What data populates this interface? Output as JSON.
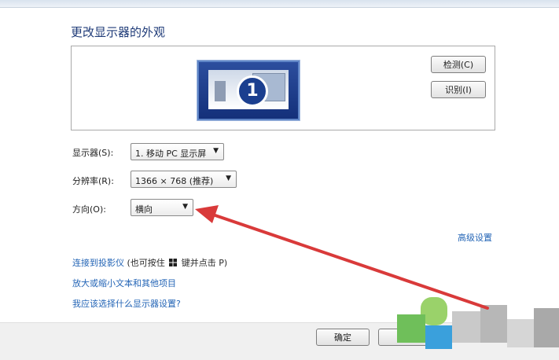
{
  "page": {
    "title": "更改显示器的外观"
  },
  "preview": {
    "monitor_number": "1",
    "detect_label": "检测(C)",
    "identify_label": "识别(I)"
  },
  "settings": {
    "display_label": "显示器(S):",
    "display_value": "1. 移动 PC 显示屏",
    "resolution_label": "分辨率(R):",
    "resolution_value": "1366 × 768 (推荐)",
    "orientation_label": "方向(O):",
    "orientation_value": "横向"
  },
  "links": {
    "advanced": "高级设置",
    "projector": "连接到投影仪",
    "projector_hint_pre": "(也可按住",
    "projector_hint_post": "键并点击 P)",
    "text_size": "放大或缩小文本和其他项目",
    "which_settings": "我应该选择什么显示器设置?"
  },
  "footer": {
    "ok_label": "确定"
  },
  "colors": {
    "link": "#2465b6",
    "title": "#1f3b78",
    "arrow": "#d93a3a",
    "monitor_fill": "#14307a"
  },
  "icons": {
    "dropdown": "chevron-down-icon",
    "windows_key": "windows-logo-icon"
  }
}
